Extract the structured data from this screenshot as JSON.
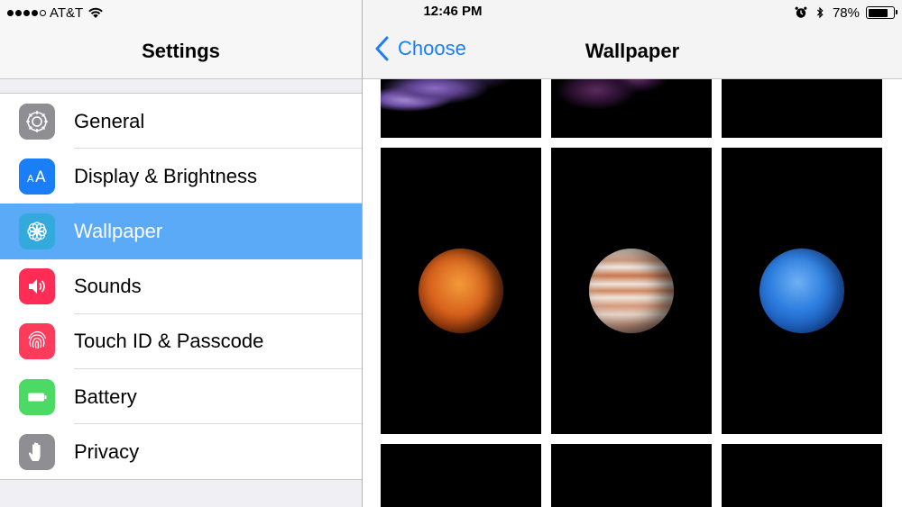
{
  "status_bar": {
    "carrier": "AT&T",
    "signal_bars_filled": 4,
    "signal_bars_total": 5,
    "time": "12:46 PM",
    "battery_percent_text": "78%",
    "battery_level": 0.78,
    "icons": [
      "wifi-icon",
      "alarm-icon",
      "bluetooth-icon",
      "battery-icon"
    ]
  },
  "master": {
    "title": "Settings",
    "items": [
      {
        "label": "General",
        "icon": "gear-icon",
        "color": "#8e8e93",
        "selected": false
      },
      {
        "label": "Display & Brightness",
        "icon": "text-size-icon",
        "color": "#1a7ef7",
        "selected": false
      },
      {
        "label": "Wallpaper",
        "icon": "flower-icon",
        "color": "#34aadc",
        "selected": true
      },
      {
        "label": "Sounds",
        "icon": "speaker-icon",
        "color": "#ff2d55",
        "selected": false
      },
      {
        "label": "Touch ID & Passcode",
        "icon": "fingerprint-icon",
        "color": "#ff3b5c",
        "selected": false
      },
      {
        "label": "Battery",
        "icon": "battery-icon",
        "color": "#4cd964",
        "selected": false
      },
      {
        "label": "Privacy",
        "icon": "hand-icon",
        "color": "#8e8e93",
        "selected": false
      }
    ]
  },
  "detail": {
    "back_label": "Choose",
    "title": "Wallpaper",
    "wallpapers": [
      {
        "name": "purple-flower",
        "kind": "flower"
      },
      {
        "name": "pink-flower",
        "kind": "flower"
      },
      {
        "name": "dark-flower",
        "kind": "flower"
      },
      {
        "name": "mars",
        "kind": "planet"
      },
      {
        "name": "jupiter",
        "kind": "planet"
      },
      {
        "name": "neptune",
        "kind": "planet"
      },
      {
        "name": "black-1",
        "kind": "dark"
      },
      {
        "name": "black-2",
        "kind": "dark"
      },
      {
        "name": "black-3",
        "kind": "dark"
      }
    ]
  },
  "colors": {
    "selected_row": "#5aaaf8",
    "tint": "#1a7ef7"
  }
}
